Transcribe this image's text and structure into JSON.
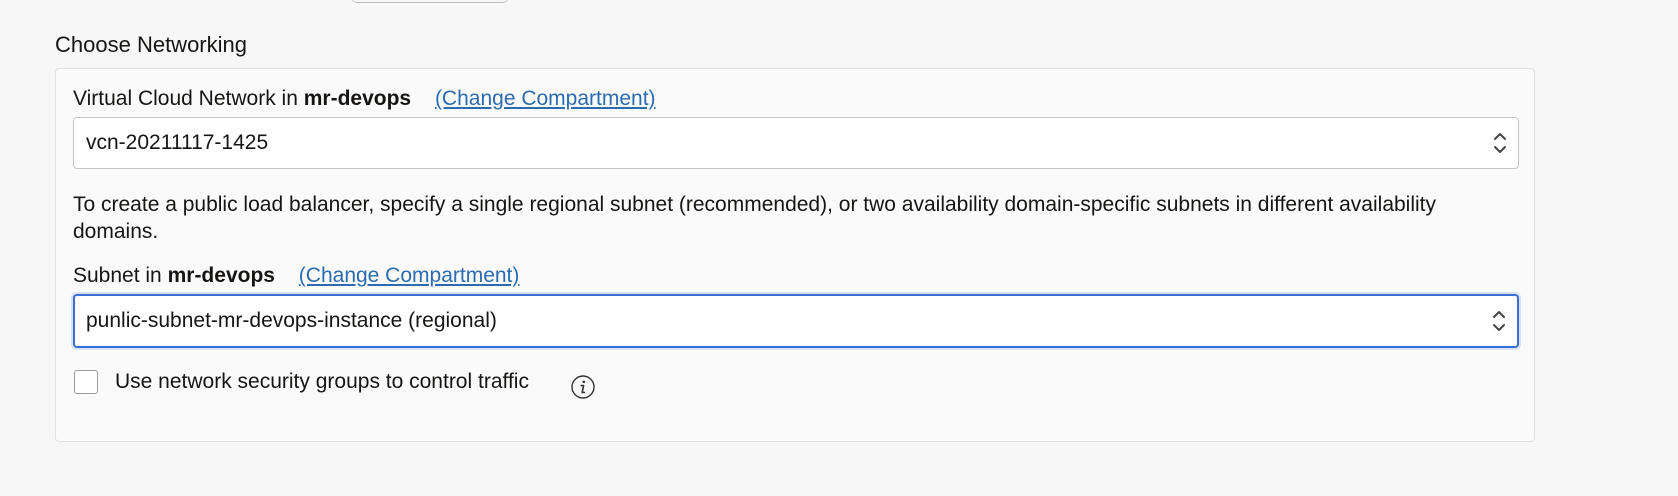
{
  "section": {
    "title": "Choose Networking"
  },
  "vcn": {
    "label_prefix": "Virtual Cloud Network in",
    "compartment": "mr-devops",
    "change_link": "(Change Compartment)",
    "value": "vcn-20211117-1425"
  },
  "help_text": "To create a public load balancer, specify a single regional subnet (recommended), or two availability domain-specific subnets in different availability domains.",
  "subnet": {
    "label_prefix": "Subnet in",
    "compartment": "mr-devops",
    "change_link": "(Change Compartment)",
    "value": "punlic-subnet-mr-devops-instance (regional)"
  },
  "nsg": {
    "label": "Use network security groups to control traffic",
    "checked": false,
    "info_icon": "info-icon"
  },
  "colors": {
    "link": "#2b6cb0",
    "focus_border": "#3a6fd1"
  }
}
